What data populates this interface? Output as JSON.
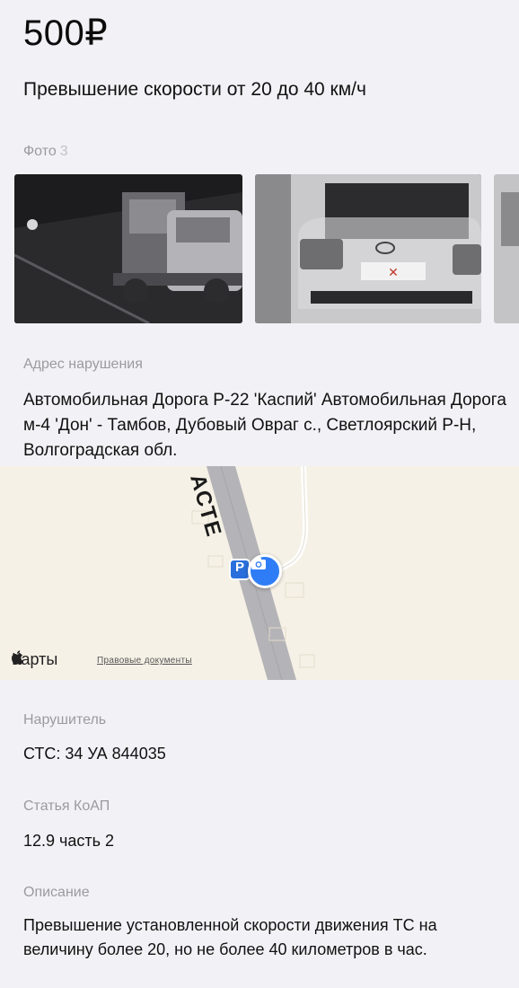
{
  "fine": {
    "amount": "500₽",
    "title": "Превышение скорости от 20 до 40 км/ч"
  },
  "photos": {
    "label": "Фото",
    "count": "3",
    "items": [
      {
        "alt": "photo-night-truck"
      },
      {
        "alt": "photo-rear-vehicle"
      },
      {
        "alt": "photo-partial"
      }
    ]
  },
  "address": {
    "label": "Адрес нарушения",
    "text": "Автомобильная Дорога Р-22 'Каспий' Автомобильная Дорога м-4 'Дон' - Тамбов, Дубовый Овраг с., Светлоярский Р-Н, Волгоградская обл."
  },
  "map": {
    "road_label": "АСТЕ",
    "parking_sign": "P",
    "brand": "Карты",
    "legal": "Правовые документы"
  },
  "violator": {
    "label": "Нарушитель",
    "value": "СТС: 34 УА 844035"
  },
  "article": {
    "label": "Статья КоАП",
    "value": "12.9 часть 2"
  },
  "description": {
    "label": "Описание",
    "text": "Превышение установленной скорости движения ТС на величину более 20, но не более 40 километров в час."
  },
  "colors": {
    "background": "#f2f2f6",
    "label_gray": "#9a9aa0",
    "camera_blue": "#2f7df6",
    "map_background": "#f6f1e6"
  }
}
